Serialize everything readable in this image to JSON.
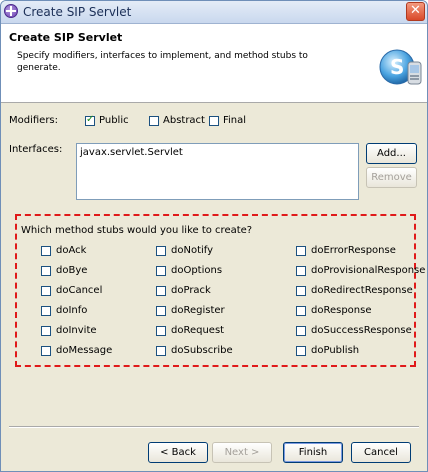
{
  "window": {
    "title": "Create SIP Servlet",
    "close_glyph": "✕"
  },
  "header": {
    "title": "Create SIP Servlet",
    "description": "Specify modifiers, interfaces to implement, and method stubs to generate."
  },
  "modifiers": {
    "label": "Modifiers:",
    "options": [
      {
        "label": "Public",
        "checked": true
      },
      {
        "label": "Abstract",
        "checked": false
      },
      {
        "label": "Final",
        "checked": false
      }
    ]
  },
  "interfaces": {
    "label": "Interfaces:",
    "items": [
      "javax.servlet.Servlet"
    ],
    "add_button": "Add...",
    "remove_button": "Remove"
  },
  "method_stubs": {
    "prompt": "Which method stubs would you like to create?",
    "columns": [
      [
        "doAck",
        "doBye",
        "doCancel",
        "doInfo",
        "doInvite",
        "doMessage"
      ],
      [
        "doNotify",
        "doOptions",
        "doPrack",
        "doRegister",
        "doRequest",
        "doSubscribe"
      ],
      [
        "doErrorResponse",
        "doProvisionalResponse",
        "doRedirectResponse",
        "doResponse",
        "doSuccessResponse",
        "doPublish"
      ]
    ]
  },
  "footer": {
    "back_button": "< Back",
    "next_button": "Next >",
    "finish_button": "Finish",
    "cancel_button": "Cancel"
  },
  "colors": {
    "highlight_border": "#e01a1a",
    "titlebar": "#c9d8ee",
    "dialog_bg": "#ece9d8"
  }
}
